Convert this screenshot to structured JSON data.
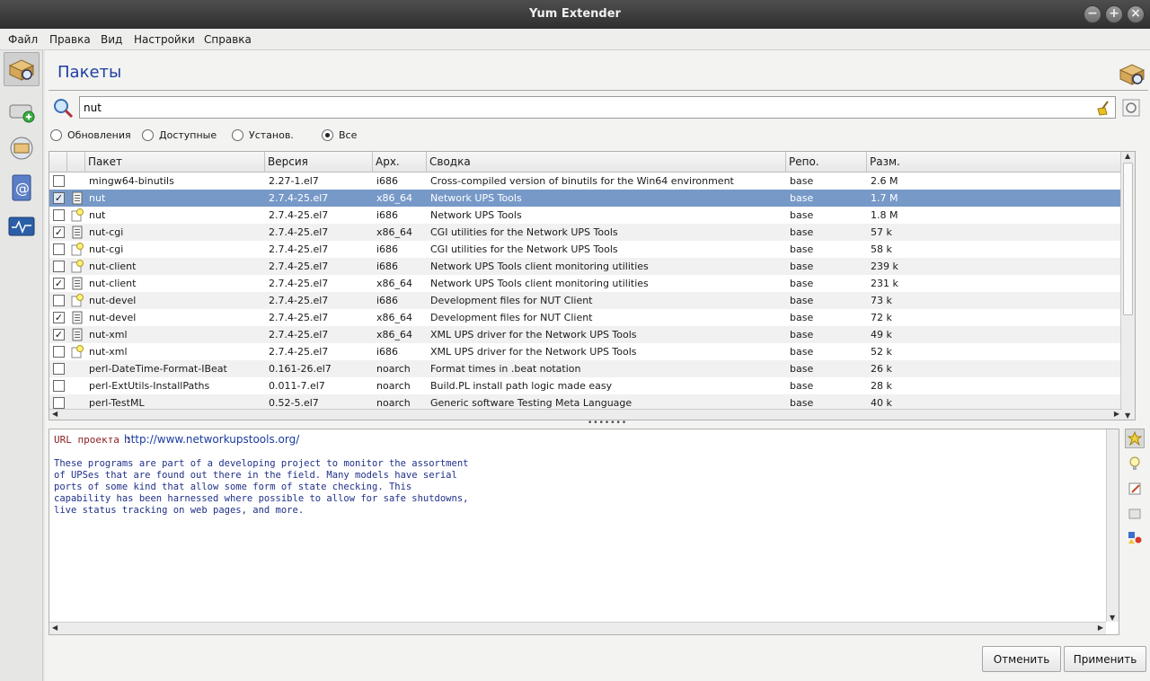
{
  "window": {
    "title": "Yum Extender"
  },
  "menu": [
    "Файл",
    "Правка",
    "Вид",
    "Настройки",
    "Справка"
  ],
  "page": {
    "title": "Пакеты"
  },
  "search": {
    "value": "nut"
  },
  "filters": {
    "options": [
      "Обновления",
      "Доступные",
      "Установ.",
      "Все"
    ],
    "selected": "Все"
  },
  "table": {
    "columns": [
      "Пакет",
      "Версия",
      "Арх.",
      "Сводка",
      "Репо.",
      "Разм."
    ],
    "rows": [
      {
        "checked": false,
        "icon": "none",
        "name": "mingw64-binutils",
        "version": "2.27-1.el7",
        "arch": "i686",
        "summary": "Cross-compiled version of binutils for the Win64 environment",
        "repo": "base",
        "size": "2.6 M"
      },
      {
        "checked": true,
        "icon": "package-icon",
        "name": "nut",
        "version": "2.7.4-25.el7",
        "arch": "x86_64",
        "summary": "Network UPS Tools",
        "repo": "base",
        "size": "1.7 M",
        "selected": true
      },
      {
        "checked": false,
        "icon": "available-icon",
        "name": "nut",
        "version": "2.7.4-25.el7",
        "arch": "i686",
        "summary": "Network UPS Tools",
        "repo": "base",
        "size": "1.8 M"
      },
      {
        "checked": true,
        "icon": "package-icon",
        "name": "nut-cgi",
        "version": "2.7.4-25.el7",
        "arch": "x86_64",
        "summary": "CGI utilities for the Network UPS Tools",
        "repo": "base",
        "size": "57 k"
      },
      {
        "checked": false,
        "icon": "available-icon",
        "name": "nut-cgi",
        "version": "2.7.4-25.el7",
        "arch": "i686",
        "summary": "CGI utilities for the Network UPS Tools",
        "repo": "base",
        "size": "58 k"
      },
      {
        "checked": false,
        "icon": "available-icon",
        "name": "nut-client",
        "version": "2.7.4-25.el7",
        "arch": "i686",
        "summary": "Network UPS Tools client monitoring utilities",
        "repo": "base",
        "size": "239 k"
      },
      {
        "checked": true,
        "icon": "package-icon",
        "name": "nut-client",
        "version": "2.7.4-25.el7",
        "arch": "x86_64",
        "summary": "Network UPS Tools client monitoring utilities",
        "repo": "base",
        "size": "231 k"
      },
      {
        "checked": false,
        "icon": "available-icon",
        "name": "nut-devel",
        "version": "2.7.4-25.el7",
        "arch": "i686",
        "summary": "Development files for NUT Client",
        "repo": "base",
        "size": "73 k"
      },
      {
        "checked": true,
        "icon": "package-icon",
        "name": "nut-devel",
        "version": "2.7.4-25.el7",
        "arch": "x86_64",
        "summary": "Development files for NUT Client",
        "repo": "base",
        "size": "72 k"
      },
      {
        "checked": true,
        "icon": "package-icon",
        "name": "nut-xml",
        "version": "2.7.4-25.el7",
        "arch": "x86_64",
        "summary": "XML UPS driver for the Network UPS Tools",
        "repo": "base",
        "size": "49 k"
      },
      {
        "checked": false,
        "icon": "available-icon",
        "name": "nut-xml",
        "version": "2.7.4-25.el7",
        "arch": "i686",
        "summary": "XML UPS driver for the Network UPS Tools",
        "repo": "base",
        "size": "52 k"
      },
      {
        "checked": false,
        "icon": "none",
        "name": "perl-DateTime-Format-IBeat",
        "version": "0.161-26.el7",
        "arch": "noarch",
        "summary": "Format times in .beat notation",
        "repo": "base",
        "size": "26 k"
      },
      {
        "checked": false,
        "icon": "none",
        "name": "perl-ExtUtils-InstallPaths",
        "version": "0.011-7.el7",
        "arch": "noarch",
        "summary": "Build.PL install path logic made easy",
        "repo": "base",
        "size": "28 k"
      },
      {
        "checked": false,
        "icon": "none",
        "name": "perl-TestML",
        "version": "0.52-5.el7",
        "arch": "noarch",
        "summary": "Generic software Testing Meta Language",
        "repo": "base",
        "size": "40 k"
      }
    ]
  },
  "detail": {
    "url_label": "URL проекта :",
    "url": "http://www.networkupstools.org/",
    "description": "These programs are part of a developing project to monitor the assortment\nof UPSes that are found out there in the field. Many models have serial\nports of some kind that allow some form of state checking. This\ncapability has been harnessed where possible to allow for safe shutdowns,\nlive status tracking on web pages, and more."
  },
  "buttons": {
    "cancel": "Отменить",
    "apply": "Применить"
  }
}
